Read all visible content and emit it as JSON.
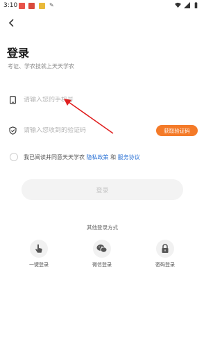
{
  "status_bar": {
    "time": "3:10",
    "pen_glyph": "✎"
  },
  "header": {
    "back_icon": "chevron-left-icon",
    "title": "登录",
    "subtitle": "考证、学农技就上天天学农"
  },
  "form": {
    "phone_placeholder": "请输入您的手机号",
    "code_placeholder": "请输入您收到的验证码",
    "get_code_label": "获取验证码",
    "agree_text": "我已阅读并同意天天学农",
    "privacy_link": "隐私政策",
    "and_text": "和",
    "service_link": "服务协议",
    "login_label": "登录"
  },
  "other_login": {
    "title": "其他登录方式",
    "items": [
      {
        "label": "一键登录",
        "icon": "tap-icon"
      },
      {
        "label": "微信登录",
        "icon": "wechat-icon"
      },
      {
        "label": "密码登录",
        "icon": "lock-icon"
      }
    ]
  },
  "colors": {
    "accent": "#f47a28",
    "link": "#2e74d6",
    "annotation_arrow": "#e02020"
  }
}
